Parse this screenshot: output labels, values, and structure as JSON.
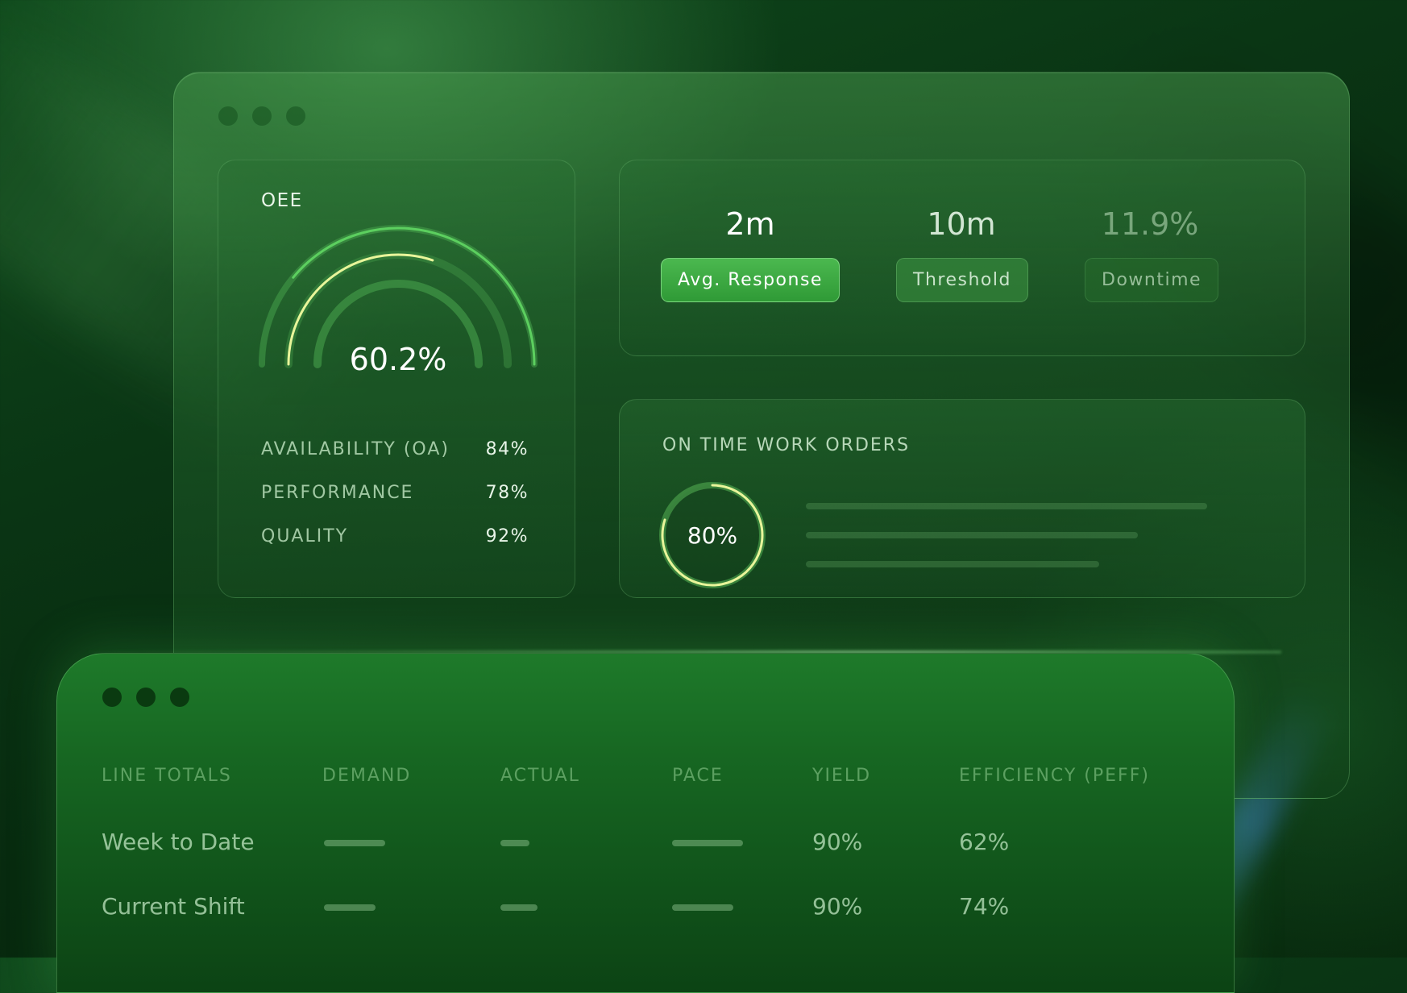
{
  "colors": {
    "accent": "#4bb84f",
    "gauge_highlight": "#e8f59a",
    "ring_highlight": "#e8f59a"
  },
  "oee": {
    "title": "OEE",
    "value": "60.2%",
    "value_fraction": 0.602,
    "metrics": [
      {
        "label": "AVAILABILITY (OA)",
        "value": "84%"
      },
      {
        "label": "PERFORMANCE",
        "value": "78%"
      },
      {
        "label": "QUALITY",
        "value": "92%"
      }
    ]
  },
  "kpis": [
    {
      "value": "2m",
      "label": "Avg. Response"
    },
    {
      "value": "10m",
      "label": "Threshold"
    },
    {
      "value": "11.9%",
      "label": "Downtime"
    }
  ],
  "on_time_work_orders": {
    "title": "ON TIME WORK ORDERS",
    "value": "80%",
    "fraction": 0.8
  },
  "line_totals": {
    "headers": [
      "LINE TOTALS",
      "DEMAND",
      "ACTUAL",
      "PACE",
      "YIELD",
      "EFFICIENCY (PEFF)"
    ],
    "rows": [
      {
        "name": "Week to Date",
        "yield": "90%",
        "efficiency": "62%"
      },
      {
        "name": "Current Shift",
        "yield": "90%",
        "efficiency": "74%"
      }
    ]
  }
}
